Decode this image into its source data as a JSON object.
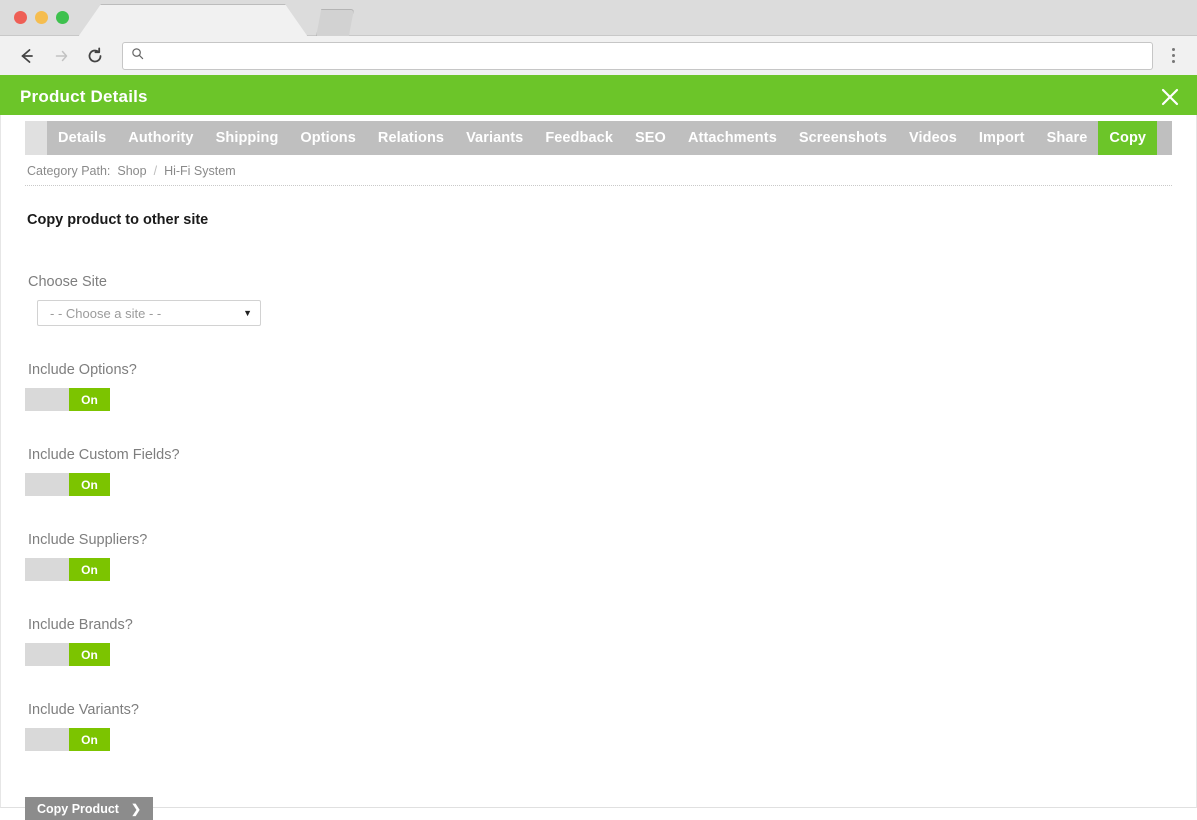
{
  "browser": {
    "traffic_lights": [
      "close",
      "minimize",
      "maximize"
    ],
    "back_icon": "back-arrow-icon",
    "forward_icon": "forward-arrow-icon",
    "reload_icon": "reload-icon",
    "search_icon": "search-icon",
    "address_value": "",
    "address_placeholder": "",
    "menu_icon": "kebab-menu-icon",
    "new_tab_label": ""
  },
  "app": {
    "title": "Product Details",
    "close_label": "×",
    "accent_color": "#6cc529",
    "tabbar_color": "#bfbfbf"
  },
  "tabs": [
    {
      "label": "Details",
      "active": false
    },
    {
      "label": "Authority",
      "active": false
    },
    {
      "label": "Shipping",
      "active": false
    },
    {
      "label": "Options",
      "active": false
    },
    {
      "label": "Relations",
      "active": false
    },
    {
      "label": "Variants",
      "active": false
    },
    {
      "label": "Feedback",
      "active": false
    },
    {
      "label": "SEO",
      "active": false
    },
    {
      "label": "Attachments",
      "active": false
    },
    {
      "label": "Screenshots",
      "active": false
    },
    {
      "label": "Videos",
      "active": false
    },
    {
      "label": "Import",
      "active": false
    },
    {
      "label": "Share",
      "active": false
    },
    {
      "label": "Copy",
      "active": true
    }
  ],
  "breadcrumb": {
    "label": "Category Path:",
    "items": [
      "Shop",
      "Hi-Fi System"
    ],
    "separator": "/"
  },
  "main": {
    "section_title": "Copy product to other site",
    "choose_site": {
      "label": "Choose Site",
      "selected": "- - Choose a site - -",
      "caret": "▼"
    },
    "toggles": [
      {
        "label": "Include Options?",
        "state": "On"
      },
      {
        "label": "Include Custom Fields?",
        "state": "On"
      },
      {
        "label": "Include Suppliers?",
        "state": "On"
      },
      {
        "label": "Include Brands?",
        "state": "On"
      },
      {
        "label": "Include Variants?",
        "state": "On"
      }
    ],
    "submit": {
      "label": "Copy Product",
      "chevron": "❯"
    }
  }
}
